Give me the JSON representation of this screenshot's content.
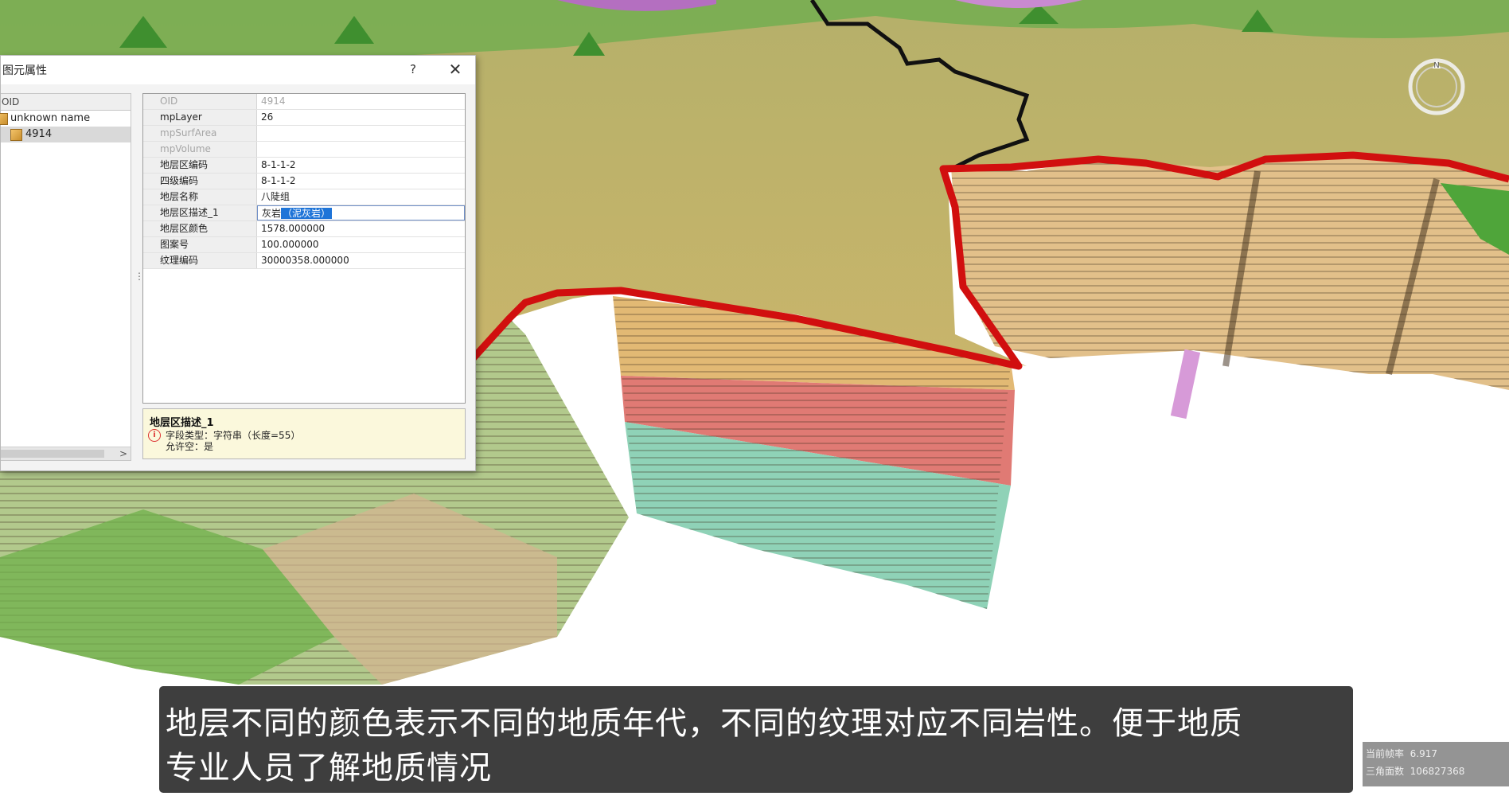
{
  "dialog": {
    "title": "图元属性",
    "help_label": "?",
    "close_label": "✕",
    "tree": {
      "column_header": "OID",
      "items": [
        {
          "label": "unknown name"
        },
        {
          "label": "4914"
        }
      ]
    },
    "properties": [
      {
        "name": "OID",
        "value": "4914"
      },
      {
        "name": "mpLayer",
        "value": "26"
      },
      {
        "name": "mpSurfArea",
        "value": ""
      },
      {
        "name": "mpVolume",
        "value": ""
      },
      {
        "name": "地层区编码",
        "value": "8-1-1-2"
      },
      {
        "name": "四级编码",
        "value": "8-1-1-2"
      },
      {
        "name": "地层名称",
        "value": "八陡组"
      },
      {
        "name": "地层区描述_1",
        "value": "灰岩",
        "value_selected": "（泥灰岩）"
      },
      {
        "name": "地层区颜色",
        "value": "1578.000000"
      },
      {
        "name": "图案号",
        "value": "100.000000"
      },
      {
        "name": "纹理编码",
        "value": "30000358.000000"
      }
    ],
    "field_info": {
      "title": "地层区描述_1",
      "type_line": "字段类型：字符串（长度=55）",
      "nullable_line": "允许空：是"
    }
  },
  "compass": {
    "north_label": "N"
  },
  "subtitle": {
    "line1": "地层不同的颜色表示不同的地质年代，不同的纹理对应不同岩性。便于地质",
    "line2": "专业人员了解地质情况"
  },
  "stats": {
    "fps_label": "当前帧率",
    "fps_value": "6.917",
    "tri_label": "三角面数",
    "tri_value": "106827368"
  },
  "colors": {
    "terrain": "#c8b567",
    "boundary": "#d10f0f",
    "strata_tan": "#e2b974",
    "strata_red": "#e07a74",
    "strata_teal": "#8fd2b7",
    "selection": "#1e74d8"
  }
}
